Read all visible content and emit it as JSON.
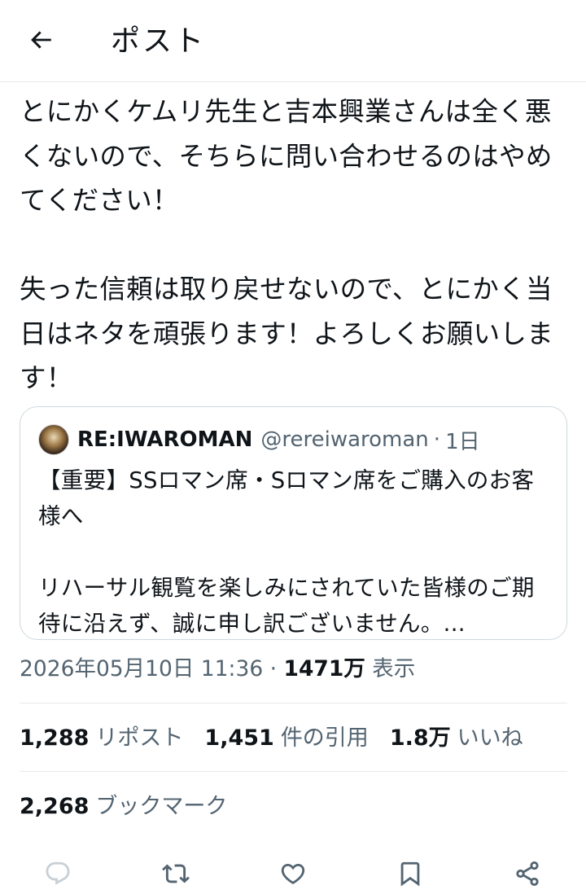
{
  "header": {
    "title": "ポスト",
    "back_icon": "arrow-left-icon"
  },
  "tweet": {
    "paragraphs": [
      "とにかくケムリ先生と吉本興業さんは全く悪くないので、そちらに問い合わせるのはやめてください！",
      "失った信頼は取り戻せないので、とにかく当日はネタを頑張ります！よろしくお願いします！"
    ]
  },
  "quote": {
    "name": "RE:IWAROMAN",
    "handle": "@rereiwaroman",
    "separator": "·",
    "time": "1日",
    "paragraphs": [
      "【重要】SSロマン席・Sロマン席をご購入のお客様へ",
      "リハーサル観覧を楽しみにされていた皆様のご期待に沿えず、誠に申し訳ございません。..."
    ]
  },
  "meta": {
    "timestamp": "2026年05月10日 11:36",
    "separator": "·",
    "views": "1471万",
    "views_label": "表示"
  },
  "stats": {
    "reposts": {
      "count": "1,288",
      "label": "リポスト"
    },
    "quotes": {
      "count": "1,451",
      "label": "件の引用"
    },
    "likes": {
      "count": "1.8万",
      "label": "いいね"
    }
  },
  "bookmarks": {
    "count": "2,268",
    "label": "ブックマーク"
  },
  "actions": [
    "reply-icon",
    "repost-icon",
    "like-icon",
    "bookmark-icon",
    "share-icon"
  ],
  "colors": {
    "text": "#0f1419",
    "secondary": "#536471",
    "border": "#cfd9de",
    "icon": "#536471"
  }
}
